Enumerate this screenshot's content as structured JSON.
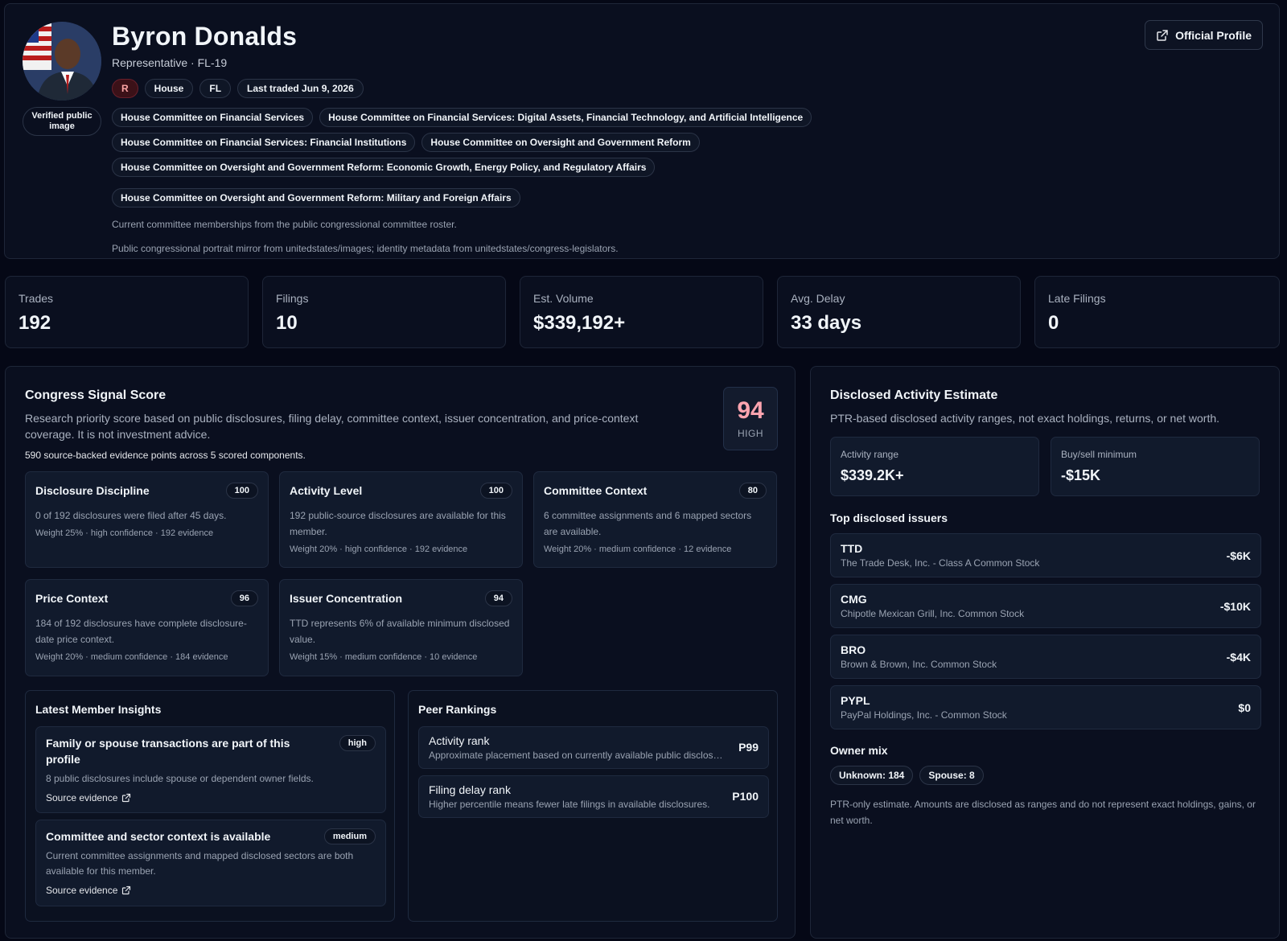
{
  "member": {
    "name": "Byron Donalds",
    "role": "Representative · FL-19",
    "verified_label": "Verified public image",
    "official_profile_label": "Official Profile",
    "tags": {
      "party": "R",
      "chamber": "House",
      "state": "FL",
      "last_traded": "Last traded Jun 9, 2026"
    },
    "committees": [
      "House Committee on Financial Services",
      "House Committee on Financial Services: Digital Assets, Financial Technology, and Artificial Intelligence",
      "House Committee on Financial Services: Financial Institutions",
      "House Committee on Oversight and Government Reform",
      "House Committee on Oversight and Government Reform: Economic Growth, Energy Policy, and Regulatory Affairs",
      "House Committee on Oversight and Government Reform: Military and Foreign Affairs"
    ],
    "committee_note": "Current committee memberships from the public congressional committee roster.",
    "image_note": "Public congressional portrait mirror from unitedstates/images; identity metadata from unitedstates/congress-legislators."
  },
  "stats": [
    {
      "label": "Trades",
      "value": "192"
    },
    {
      "label": "Filings",
      "value": "10"
    },
    {
      "label": "Est. Volume",
      "value": "$339,192+"
    },
    {
      "label": "Avg. Delay",
      "value": "33 days"
    },
    {
      "label": "Late Filings",
      "value": "0"
    }
  ],
  "signal": {
    "title": "Congress Signal Score",
    "description": "Research priority score based on public disclosures, filing delay, committee context, issuer concentration, and price-context coverage. It is not investment advice.",
    "evidence": "590 source-backed evidence points across 5 scored components.",
    "score": "94",
    "level": "HIGH",
    "components": [
      {
        "name": "Disclosure Discipline",
        "score": "100",
        "desc": "0 of 192 disclosures were filed after 45 days.",
        "meta": "Weight 25% · high confidence · 192 evidence"
      },
      {
        "name": "Activity Level",
        "score": "100",
        "desc": "192 public-source disclosures are available for this member.",
        "meta": "Weight 20% · high confidence · 192 evidence"
      },
      {
        "name": "Committee Context",
        "score": "80",
        "desc": "6 committee assignments and 6 mapped sectors are available.",
        "meta": "Weight 20% · medium confidence · 12 evidence"
      },
      {
        "name": "Price Context",
        "score": "96",
        "desc": "184 of 192 disclosures have complete disclosure-date price context.",
        "meta": "Weight 20% · medium confidence · 184 evidence"
      },
      {
        "name": "Issuer Concentration",
        "score": "94",
        "desc": "TTD represents 6% of available minimum disclosed value.",
        "meta": "Weight 15% · medium confidence · 10 evidence"
      }
    ]
  },
  "insights": {
    "title": "Latest Member Insights",
    "items": [
      {
        "title": "Family or spouse transactions are part of this profile",
        "badge": "high",
        "desc": "8 public disclosures include spouse or dependent owner fields.",
        "link": "Source evidence"
      },
      {
        "title": "Committee and sector context is available",
        "badge": "medium",
        "desc": "Current committee assignments and mapped disclosed sectors are both available for this member.",
        "link": "Source evidence"
      }
    ]
  },
  "rankings": {
    "title": "Peer Rankings",
    "items": [
      {
        "title": "Activity rank",
        "desc": "Approximate placement based on currently available public disclosures.",
        "value": "P99"
      },
      {
        "title": "Filing delay rank",
        "desc": "Higher percentile means fewer late filings in available disclosures.",
        "value": "P100"
      }
    ]
  },
  "activity": {
    "title": "Disclosed Activity Estimate",
    "description": "PTR-based disclosed activity ranges, not exact holdings, returns, or net worth.",
    "range_label": "Activity range",
    "range_value": "$339.2K+",
    "min_label": "Buy/sell minimum",
    "min_value": "-$15K",
    "issuers_title": "Top disclosed issuers",
    "issuers": [
      {
        "ticker": "TTD",
        "name": "The Trade Desk, Inc. - Class A Common Stock",
        "value": "-$6K"
      },
      {
        "ticker": "CMG",
        "name": "Chipotle Mexican Grill, Inc. Common Stock",
        "value": "-$10K"
      },
      {
        "ticker": "BRO",
        "name": "Brown & Brown, Inc. Common Stock",
        "value": "-$4K"
      },
      {
        "ticker": "PYPL",
        "name": "PayPal Holdings, Inc. - Common Stock",
        "value": "$0"
      }
    ],
    "owner_title": "Owner mix",
    "owners": [
      "Unknown: 184",
      "Spouse: 8"
    ],
    "footnote": "PTR-only estimate. Amounts are disclosed as ranges and do not represent exact holdings, gains, or net worth."
  }
}
